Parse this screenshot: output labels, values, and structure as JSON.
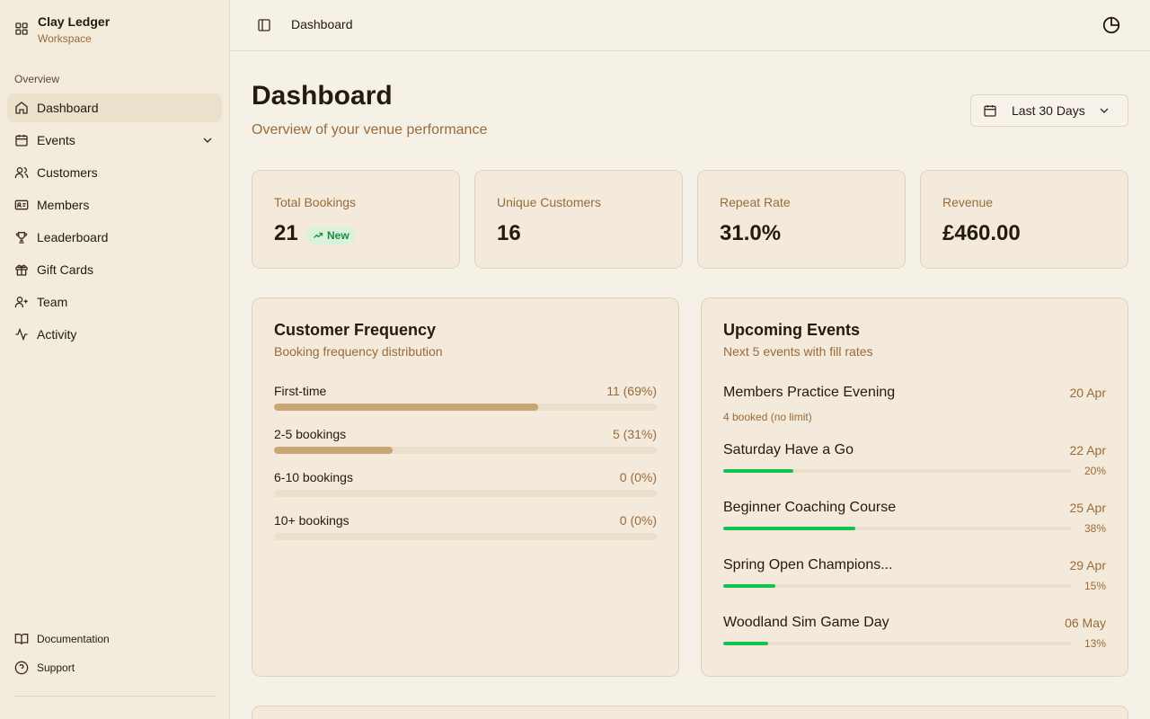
{
  "sidebar": {
    "brand": {
      "name": "Clay Ledger",
      "sub": "Workspace"
    },
    "section_label": "Overview",
    "items": [
      {
        "label": "Dashboard",
        "icon": "home-icon",
        "active": true
      },
      {
        "label": "Events",
        "icon": "calendar-icon",
        "has_submenu": true
      },
      {
        "label": "Customers",
        "icon": "users-icon"
      },
      {
        "label": "Members",
        "icon": "id-card-icon"
      },
      {
        "label": "Leaderboard",
        "icon": "trophy-icon"
      },
      {
        "label": "Gift Cards",
        "icon": "gift-icon"
      },
      {
        "label": "Team",
        "icon": "user-plus-icon"
      },
      {
        "label": "Activity",
        "icon": "activity-icon"
      }
    ],
    "footer": [
      {
        "label": "Documentation",
        "icon": "book-icon"
      },
      {
        "label": "Support",
        "icon": "help-circle-icon"
      }
    ]
  },
  "topbar": {
    "breadcrumb": "Dashboard"
  },
  "header": {
    "title": "Dashboard",
    "subtitle": "Overview of your venue performance",
    "date_range": "Last 30 Days"
  },
  "stats": [
    {
      "label": "Total Bookings",
      "value": "21",
      "badge": "New"
    },
    {
      "label": "Unique Customers",
      "value": "16"
    },
    {
      "label": "Repeat Rate",
      "value": "31.0%"
    },
    {
      "label": "Revenue",
      "value": "£460.00"
    }
  ],
  "frequency": {
    "title": "Customer Frequency",
    "subtitle": "Booking frequency distribution",
    "rows": [
      {
        "label": "First-time",
        "count": "11 (69%)",
        "fraction": 0.69
      },
      {
        "label": "2-5 bookings",
        "count": "5 (31%)",
        "fraction": 0.31
      },
      {
        "label": "6-10 bookings",
        "count": "0 (0%)",
        "fraction": 0
      },
      {
        "label": "10+ bookings",
        "count": "0 (0%)",
        "fraction": 0
      }
    ]
  },
  "events": {
    "title": "Upcoming Events",
    "subtitle": "Next 5 events with fill rates",
    "rows": [
      {
        "name": "Members Practice Evening",
        "date": "20 Apr",
        "note": "4 booked (no limit)"
      },
      {
        "name": "Saturday Have a Go",
        "date": "22 Apr",
        "pct": "20%",
        "fraction": 0.2
      },
      {
        "name": "Beginner Coaching Course",
        "date": "25 Apr",
        "pct": "38%",
        "fraction": 0.38
      },
      {
        "name": "Spring Open Champions...",
        "date": "29 Apr",
        "pct": "15%",
        "fraction": 0.15
      },
      {
        "name": "Woodland Sim Game Day",
        "date": "06 May",
        "pct": "13%",
        "fraction": 0.13
      }
    ]
  },
  "colors": {
    "accent_bar": "#c9a671",
    "fill_green": "#16c153",
    "muted_text": "#9a6a3a"
  }
}
